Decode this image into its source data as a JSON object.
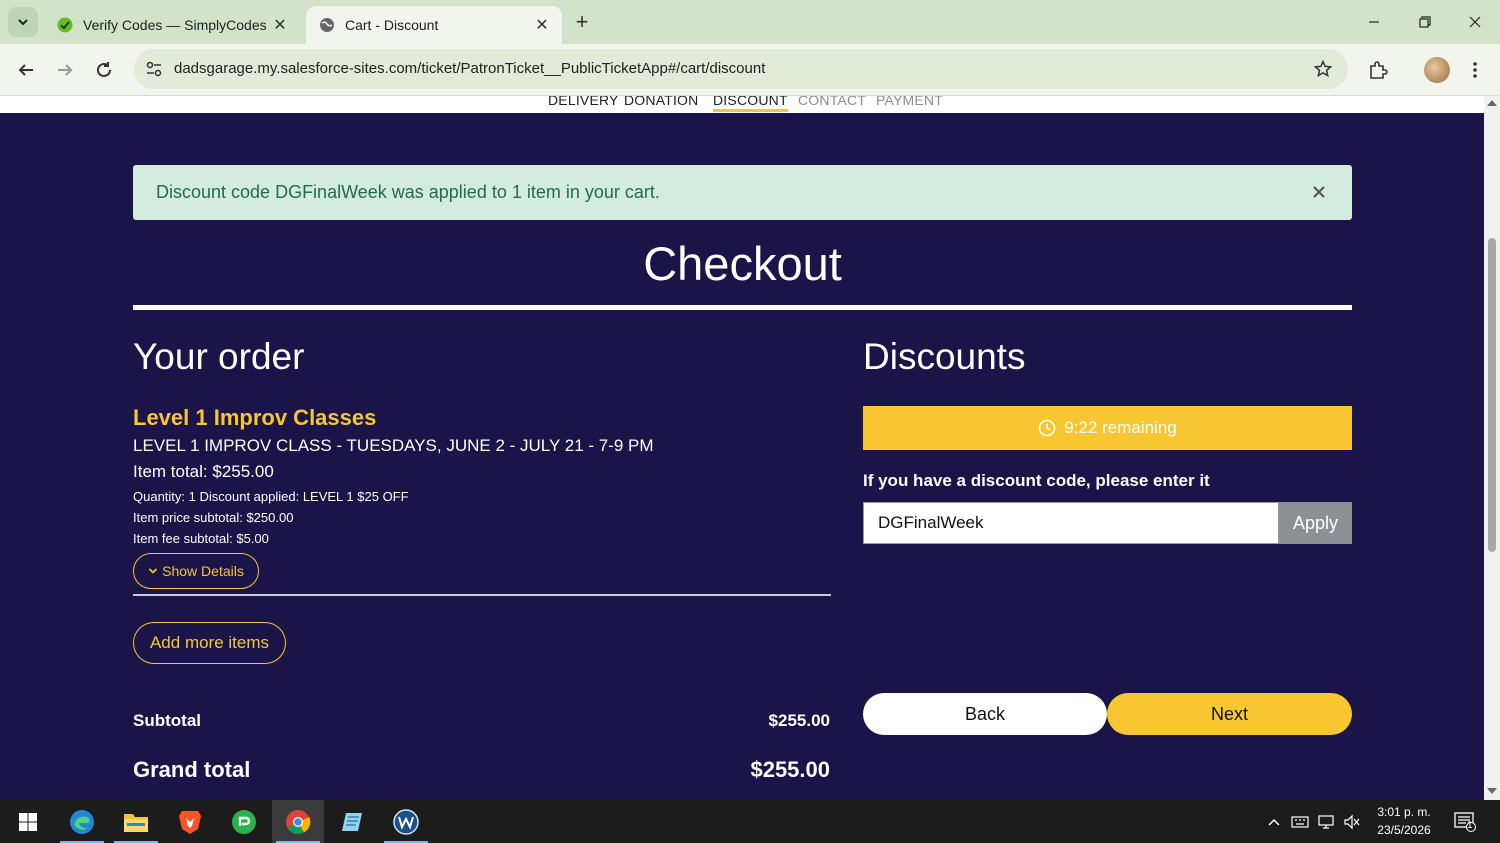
{
  "browser": {
    "tabs": [
      {
        "title": "Verify Codes — SimplyCodes",
        "active": false
      },
      {
        "title": "Cart - Discount",
        "active": true
      }
    ],
    "url": "dadsgarage.my.salesforce-sites.com/ticket/PatronTicket__PublicTicketApp#/cart/discount"
  },
  "steps": [
    {
      "label": "DELIVERY",
      "state": "done"
    },
    {
      "label": "DONATION",
      "state": "done"
    },
    {
      "label": "DISCOUNT",
      "state": "current"
    },
    {
      "label": "CONTACT",
      "state": "upcoming"
    },
    {
      "label": "PAYMENT",
      "state": "upcoming"
    }
  ],
  "alert": {
    "message": "Discount code DGFinalWeek was applied to 1 item in your cart."
  },
  "checkout": {
    "title": "Checkout"
  },
  "order": {
    "heading": "Your order",
    "item": {
      "name": "Level 1 Improv Classes",
      "subtitle": "LEVEL 1 IMPROV CLASS - TUESDAYS, JUNE 2 - JULY 21 - 7-9 PM",
      "total": "Item total: $255.00",
      "quantity_line": "Quantity: 1 Discount applied: LEVEL 1 $25 OFF",
      "price_subtotal": "Item price subtotal: $250.00",
      "fee_subtotal": "Item fee subtotal: $5.00"
    },
    "show_details_label": "Show Details",
    "add_more_label": "Add more items",
    "subtotal_label": "Subtotal",
    "subtotal_value": "$255.00",
    "grand_total_label": "Grand total",
    "grand_total_value": "$255.00"
  },
  "discounts": {
    "heading": "Discounts",
    "timer": "9:22 remaining",
    "prompt": "If you have a discount code, please enter it",
    "code_value": "DGFinalWeek",
    "apply_label": "Apply",
    "back_label": "Back",
    "next_label": "Next"
  },
  "taskbar": {
    "time": "3:01 p. m.",
    "date": "23/5/2026",
    "notification_count": "1"
  },
  "colors": {
    "page_bg": "#1a1448",
    "accent_yellow": "#f8c630",
    "alert_bg": "#d4ece0",
    "alert_text": "#226c46"
  }
}
